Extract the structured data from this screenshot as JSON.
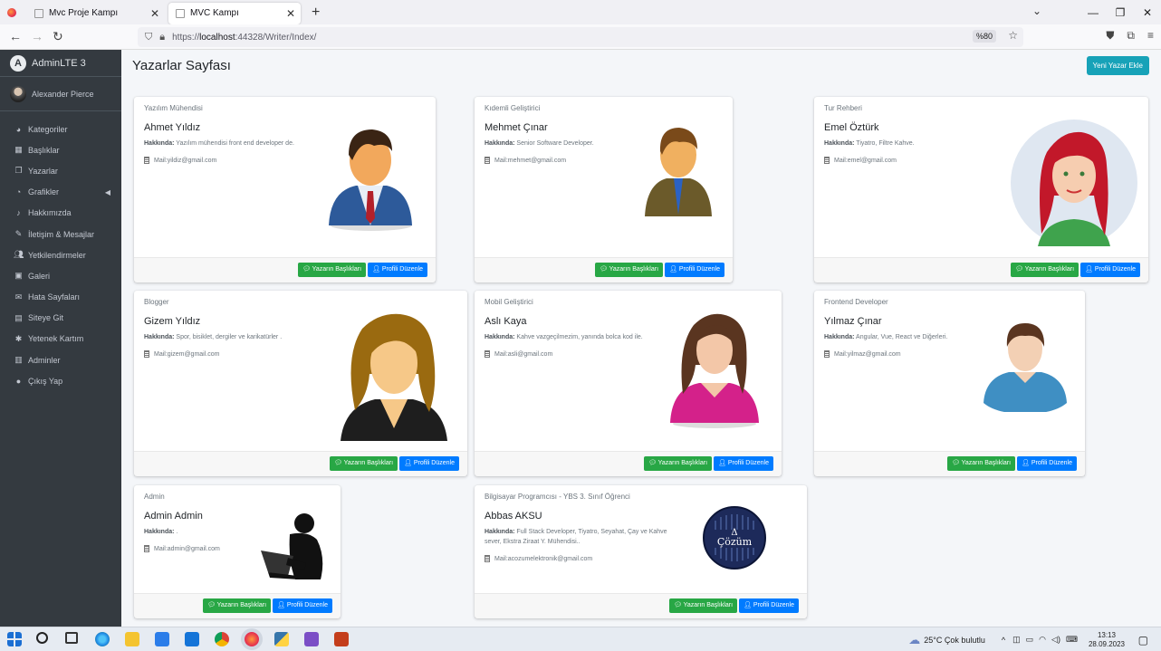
{
  "browser": {
    "tabs": [
      {
        "title": "Mvc Proje Kampı"
      },
      {
        "title": "MVC Kampı"
      }
    ],
    "url_prefix": "https://",
    "url_host": "localhost",
    "url_rest": ":44328/Writer/Index/",
    "zoom": "%80"
  },
  "sidebar": {
    "brand": "AdminLTE 3",
    "user": "Alexander Pierce",
    "items": [
      {
        "label": "Kategoriler",
        "icon": "dashboard-icon"
      },
      {
        "label": "Başlıklar",
        "icon": "grid-icon"
      },
      {
        "label": "Yazarlar",
        "icon": "copy-icon"
      },
      {
        "label": "Grafikler",
        "icon": "pie-chart-icon"
      },
      {
        "label": "Hakkımızda",
        "icon": "bell-icon"
      },
      {
        "label": "İletişim & Mesajlar",
        "icon": "edit-icon"
      },
      {
        "label": "Yetkilendirmeler",
        "icon": "users-icon"
      },
      {
        "label": "Galeri",
        "icon": "image-icon"
      },
      {
        "label": "Hata Sayfaları",
        "icon": "envelope-icon"
      },
      {
        "label": "Siteye Git",
        "icon": "newspaper-icon"
      },
      {
        "label": "Yetenek Kartım",
        "icon": "asterisk-icon"
      },
      {
        "label": "Adminler",
        "icon": "building-icon"
      },
      {
        "label": "Çıkış Yap",
        "icon": "apple-icon"
      }
    ]
  },
  "page": {
    "title": "Yazarlar Sayfası",
    "new_button": "Yeni Yazar Ekle",
    "about_label": "Hakkında:",
    "btn_posts": "Yazarın Başlıkları",
    "btn_edit": "Profili Düzenle"
  },
  "writers": [
    {
      "job": "Yazılım Mühendisi",
      "name": "Ahmet Yıldız",
      "about": "Yazılım mühendisi front end developer de.",
      "mail": "Mail:yildiz@gmail.com",
      "avatar": "businessman-avatar"
    },
    {
      "job": "Kıdemli Geliştirici",
      "name": "Mehmet Çınar",
      "about": "Senior Software Developer.",
      "mail": "Mail:mehmet@gmail.com",
      "avatar": "officer-avatar"
    },
    {
      "job": "Tur Rehberi",
      "name": "Emel Öztürk",
      "about": "Tiyatro, Filtre Kahve.",
      "mail": "Mail:emel@gmail.com",
      "avatar": "redhead-woman-avatar"
    },
    {
      "job": "Blogger",
      "name": "Gizem Yıldız",
      "about": "Spor, bisiklet, dergiler ve karikatürler .",
      "mail": "Mail:gizem@gmail.com",
      "avatar": "woman-avatar"
    },
    {
      "job": "Mobil Geliştirici",
      "name": "Aslı Kaya",
      "about": "Kahve vazgeçilmezim, yanında bolca kod ile.",
      "mail": "Mail:asli@gmail.com",
      "avatar": "woman-pink-avatar"
    },
    {
      "job": "Frontend Developer",
      "name": "Yılmaz Çınar",
      "about": "Angular, Vue, React ve Diğerleri.",
      "mail": "Mail:yilmaz@gmail.com",
      "avatar": "man-avatar"
    },
    {
      "job": "Admin",
      "name": "Admin Admin",
      "about": ".",
      "mail": "Mail:admin@gmail.com",
      "avatar": "hacker-avatar"
    },
    {
      "job": "Bilgisayar Programcısı - YBS 3. Sınıf Öğrenci",
      "name": "Abbas AKSU",
      "about": "Full Stack Developer, Tiyatro, Seyahat, Çay ve Kahve sever, Ekstra Ziraat Y. Mühendisi..",
      "mail": "Mail:acozumelektronik@gmail.com",
      "avatar": "cozum-logo",
      "logo_text": "Çözüm",
      "logo_symbol": "Δ"
    }
  ],
  "taskbar": {
    "weather": "25°C  Çok bulutlu",
    "time": "13:13",
    "date": "28.09.2023"
  }
}
